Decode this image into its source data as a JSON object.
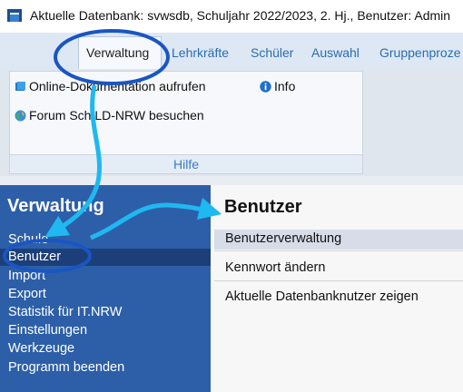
{
  "window": {
    "title": "Aktuelle Datenbank: svwsdb, Schuljahr 2022/2023, 2. Hj., Benutzer: Admin"
  },
  "ribbon": {
    "tabs": [
      {
        "label": "Verwaltung",
        "active": true
      },
      {
        "label": "Lehrkräfte",
        "active": false
      },
      {
        "label": "Schüler",
        "active": false
      },
      {
        "label": "Auswahl",
        "active": false
      },
      {
        "label": "Gruppenproze",
        "active": false
      }
    ],
    "group": {
      "label": "Hilfe",
      "buttons": {
        "online_doc": {
          "label": "Online-Dokumentation aufrufen",
          "icon": "book-icon"
        },
        "info": {
          "label": "Info",
          "icon": "info-icon"
        },
        "forum": {
          "label": "Forum SchILD-NRW besuchen",
          "icon": "globe-icon"
        }
      }
    }
  },
  "sidebar": {
    "title": "Verwaltung",
    "items": [
      {
        "label": "Schule"
      },
      {
        "label": "Benutzer",
        "selected": true
      },
      {
        "label": "Import"
      },
      {
        "label": "Export"
      },
      {
        "label": "Statistik für IT.NRW"
      },
      {
        "label": "Einstellungen"
      },
      {
        "label": "Werkzeuge"
      },
      {
        "label": "Programm beenden"
      }
    ]
  },
  "main": {
    "title": "Benutzer",
    "actions": [
      {
        "label": "Benutzerverwaltung",
        "highlighted": true
      },
      {
        "label": "Kennwort ändern"
      },
      {
        "label": "Aktuelle Datenbanknutzer zeigen"
      }
    ]
  },
  "colors": {
    "sidebar_bg": "#2d5fa8",
    "sidebar_selected": "#1d3f79",
    "tab_text": "#2b6cb0",
    "annotation_circle": "#1a56c2",
    "annotation_arrow": "#1fb8f0",
    "highlight_row": "#d6dde8"
  }
}
